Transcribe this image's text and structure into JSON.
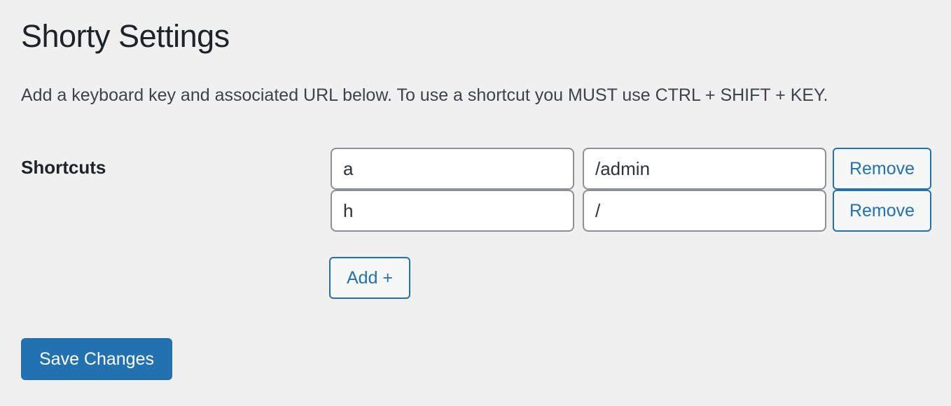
{
  "page": {
    "title": "Shorty Settings",
    "description": "Add a keyboard key and associated URL below. To use a shortcut you MUST use CTRL + SHIFT + KEY."
  },
  "shortcuts": {
    "label": "Shortcuts",
    "rows": [
      {
        "key": "a",
        "url": "/admin",
        "remove_label": "Remove"
      },
      {
        "key": "h",
        "url": "/",
        "remove_label": "Remove"
      }
    ],
    "add_label": "Add +"
  },
  "actions": {
    "save_label": "Save Changes"
  },
  "colors": {
    "background": "#f0f0f1",
    "accent": "#2271b1",
    "text": "#1d2327",
    "input_border": "#8c8f94"
  }
}
